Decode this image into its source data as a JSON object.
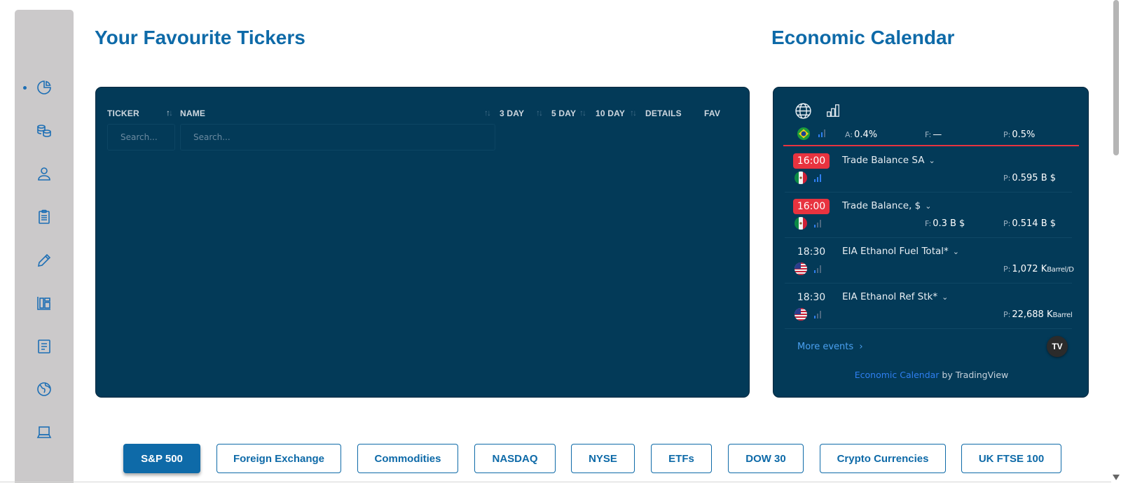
{
  "sidebar": {
    "items": [
      {
        "icon": "pie-chart-icon",
        "active": true
      },
      {
        "icon": "coins-icon"
      },
      {
        "icon": "user-icon"
      },
      {
        "icon": "clipboard-icon"
      },
      {
        "icon": "pencil-icon"
      },
      {
        "icon": "dashboard-icon"
      },
      {
        "icon": "document-icon"
      },
      {
        "icon": "globe-icon"
      },
      {
        "icon": "laptop-icon"
      }
    ]
  },
  "tickers": {
    "title": "Your Favourite Tickers",
    "columns": {
      "ticker": "TICKER",
      "name": "NAME",
      "d3": "3 DAY",
      "d5": "5 DAY",
      "d10": "10 DAY",
      "details": "DETAILS",
      "fav": "FAV"
    },
    "search_placeholder_ticker": "Search...",
    "search_placeholder_name": "Search..."
  },
  "calendar": {
    "title": "Economic Calendar",
    "top_row": {
      "flag": "brazil-flag-icon",
      "actual_label": "A:",
      "actual": "0.4%",
      "forecast_label": "F:",
      "forecast": "—",
      "prior_label": "P:",
      "prior": "0.5%"
    },
    "events": [
      {
        "time": "16:00",
        "hot": true,
        "name": "Trade Balance SA",
        "flag": "mexico-flag-icon",
        "forecast_label": "",
        "forecast": "",
        "prior_label": "P:",
        "prior": "0.595 B $",
        "prior_unit": ""
      },
      {
        "time": "16:00",
        "hot": true,
        "name": "Trade Balance, $",
        "flag": "mexico-flag-icon",
        "forecast_label": "F:",
        "forecast": "0.3 B $",
        "prior_label": "P:",
        "prior": "0.514 B $",
        "prior_unit": ""
      },
      {
        "time": "18:30",
        "hot": false,
        "name": "EIA Ethanol Fuel Total*",
        "flag": "usa-flag-icon",
        "forecast_label": "",
        "forecast": "",
        "prior_label": "P:",
        "prior": "1,072 K",
        "prior_unit": "Barrel/D"
      },
      {
        "time": "18:30",
        "hot": false,
        "name": "EIA Ethanol Ref Stk*",
        "flag": "usa-flag-icon",
        "forecast_label": "",
        "forecast": "",
        "prior_label": "P:",
        "prior": "22,688 K",
        "prior_unit": "Barrel"
      }
    ],
    "more_events": "More events",
    "footer_link": "Economic Calendar",
    "footer_text": "by TradingView",
    "logo_text": "TV"
  },
  "tabs": [
    {
      "label": "S&P 500",
      "active": true
    },
    {
      "label": "Foreign Exchange"
    },
    {
      "label": "Commodities"
    },
    {
      "label": "NASDAQ"
    },
    {
      "label": "NYSE"
    },
    {
      "label": "ETFs"
    },
    {
      "label": "DOW 30"
    },
    {
      "label": "Crypto Currencies"
    },
    {
      "label": "UK FTSE 100"
    }
  ],
  "colors": {
    "brand_blue": "#0e6aa8",
    "panel_bg": "#033a58",
    "hot_time": "#e8333f",
    "sidebar_bg": "#cbc9ca"
  }
}
